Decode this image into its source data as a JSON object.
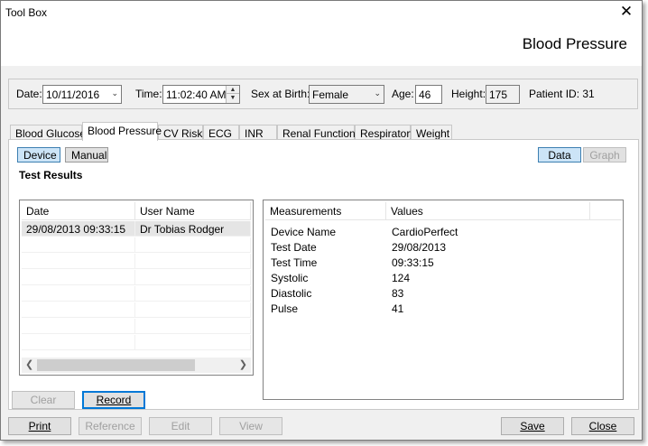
{
  "window": {
    "title": "Tool Box",
    "header": "Blood Pressure"
  },
  "patient": {
    "date_label": "Date:",
    "date_value": "10/11/2016",
    "time_label": "Time:",
    "time_value": "11:02:40 AM",
    "sex_label": "Sex at Birth:",
    "sex_value": "Female",
    "age_label": "Age:",
    "age_value": "46",
    "height_label": "Height:",
    "height_value": "175",
    "patient_id": "Patient ID: 31"
  },
  "tabs": [
    {
      "label": "Blood Glucose",
      "active": false
    },
    {
      "label": "Blood Pressure",
      "active": true
    },
    {
      "label": "CV Risk",
      "active": false
    },
    {
      "label": "ECG",
      "active": false
    },
    {
      "label": "INR",
      "active": false
    },
    {
      "label": "Renal Function",
      "active": false
    },
    {
      "label": "Respiratory",
      "active": false
    },
    {
      "label": "Weight",
      "active": false
    }
  ],
  "panel": {
    "device_label": "Device",
    "manual_label": "Manual",
    "data_label": "Data",
    "graph_label": "Graph",
    "section_title": "Test Results",
    "results_columns": [
      "Date",
      "User Name"
    ],
    "results_rows": [
      {
        "date": "29/08/2013 09:33:15",
        "user": "Dr Tobias Rodger"
      }
    ],
    "measurements_columns": [
      "Measurements",
      "Values"
    ],
    "measurements": [
      {
        "name": "Device Name",
        "value": "CardioPerfect"
      },
      {
        "name": "Test Date",
        "value": "29/08/2013"
      },
      {
        "name": "Test Time",
        "value": "09:33:15"
      },
      {
        "name": "Systolic",
        "value": "124"
      },
      {
        "name": "Diastolic",
        "value": "83"
      },
      {
        "name": "Pulse",
        "value": "41"
      }
    ],
    "clear_label": "Clear",
    "record_label": "Record"
  },
  "footer": {
    "print_label": "Print",
    "reference_label": "Reference",
    "edit_label": "Edit",
    "view_label": "View",
    "save_label": "Save",
    "close_label": "Close"
  }
}
